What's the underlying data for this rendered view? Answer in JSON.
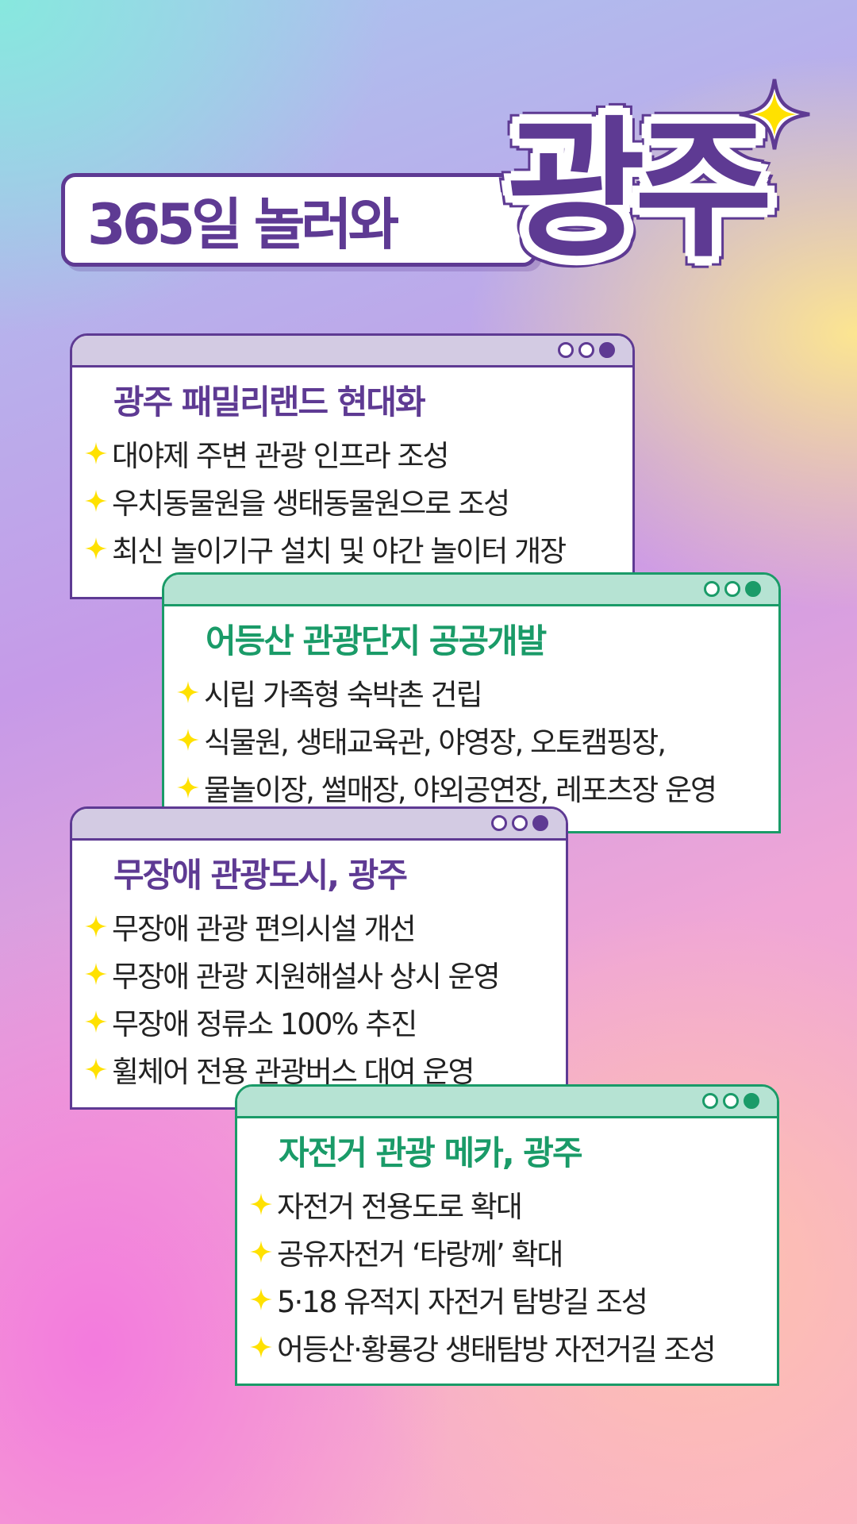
{
  "title": {
    "small": "365일 놀러와",
    "big": "광주"
  },
  "colors": {
    "purple": "#5e3a93",
    "green": "#1a9b68",
    "star": "#ffe100"
  },
  "cards": [
    {
      "title": "광주 패밀리랜드 현대화",
      "items": [
        "대야제 주변 관광 인프라 조성",
        "우치동물원을 생태동물원으로 조성",
        "최신 놀이기구 설치 및 야간 놀이터 개장"
      ]
    },
    {
      "title": "어등산 관광단지 공공개발",
      "items": [
        "시립 가족형 숙박촌 건립",
        "식물원, 생태교육관, 야영장, 오토캠핑장,",
        "물놀이장, 썰매장, 야외공연장, 레포츠장 운영"
      ]
    },
    {
      "title": "무장애 관광도시, 광주",
      "items": [
        "무장애 관광 편의시설 개선",
        "무장애 관광 지원해설사 상시 운영",
        "무장애 정류소 100% 추진",
        "휠체어 전용 관광버스 대여 운영"
      ]
    },
    {
      "title": "자전거 관광 메카, 광주",
      "items": [
        "자전거 전용도로 확대",
        "공유자전거 ‘타랑께’ 확대",
        "5·18 유적지 자전거 탐방길 조성",
        "어등산·황룡강 생태탐방 자전거길 조성"
      ]
    }
  ]
}
